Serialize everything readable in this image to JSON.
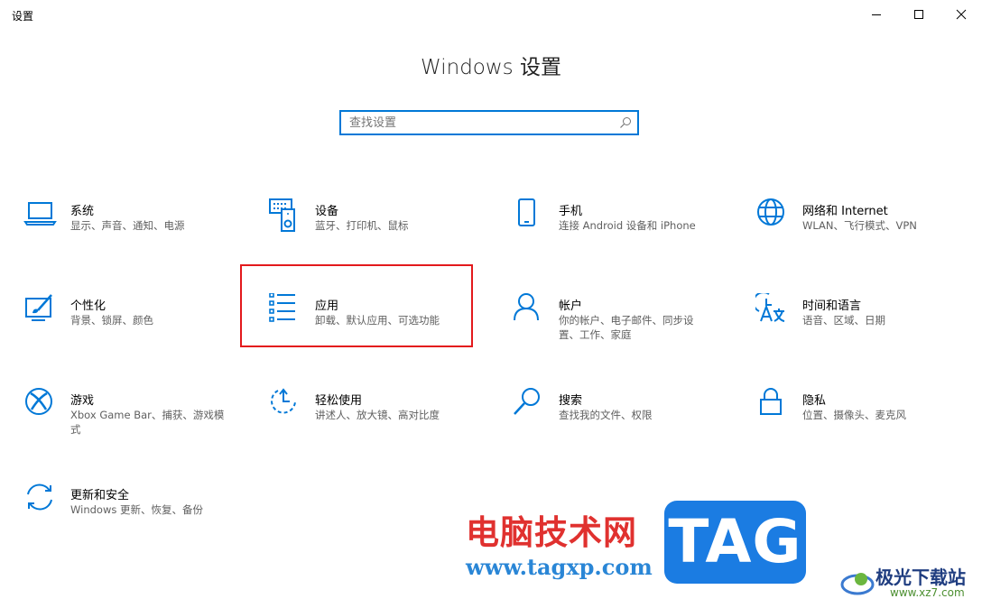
{
  "window": {
    "title": "设置",
    "controls": [
      "minimize-icon",
      "maximize-icon",
      "close-icon"
    ]
  },
  "page": {
    "title": "Windows 设置"
  },
  "search": {
    "placeholder": "查找设置",
    "value": ""
  },
  "accent_color": "#0078d7",
  "highlight_color": "#e3191c",
  "categories": [
    {
      "title": "系统",
      "subtitle": "显示、声音、通知、电源",
      "icon": "laptop-icon"
    },
    {
      "title": "设备",
      "subtitle": "蓝牙、打印机、鼠标",
      "icon": "devices-icon"
    },
    {
      "title": "手机",
      "subtitle": "连接 Android 设备和 iPhone",
      "icon": "phone-icon"
    },
    {
      "title": "网络和 Internet",
      "subtitle": "WLAN、飞行模式、VPN",
      "icon": "globe-icon"
    },
    {
      "title": "个性化",
      "subtitle": "背景、锁屏、颜色",
      "icon": "personalization-icon"
    },
    {
      "title": "应用",
      "subtitle": "卸载、默认应用、可选功能",
      "icon": "apps-list-icon"
    },
    {
      "title": "帐户",
      "subtitle": "你的帐户、电子邮件、同步设置、工作、家庭",
      "icon": "person-icon"
    },
    {
      "title": "时间和语言",
      "subtitle": "语音、区域、日期",
      "icon": "time-language-icon"
    },
    {
      "title": "游戏",
      "subtitle": "Xbox Game Bar、捕获、游戏模式",
      "icon": "xbox-icon"
    },
    {
      "title": "轻松使用",
      "subtitle": "讲述人、放大镜、高对比度",
      "icon": "ease-of-access-icon"
    },
    {
      "title": "搜索",
      "subtitle": "查找我的文件、权限",
      "icon": "search-icon"
    },
    {
      "title": "隐私",
      "subtitle": "位置、摄像头、麦克风",
      "icon": "lock-icon"
    },
    {
      "title": "更新和安全",
      "subtitle": "Windows 更新、恢复、备份",
      "icon": "sync-icon"
    }
  ],
  "watermark": {
    "site_cn": "电脑技术网",
    "site_url": "www.tagxp.com",
    "tag": "TAG",
    "brand": "极光下载站",
    "brand_url": "www.xz7.com"
  }
}
